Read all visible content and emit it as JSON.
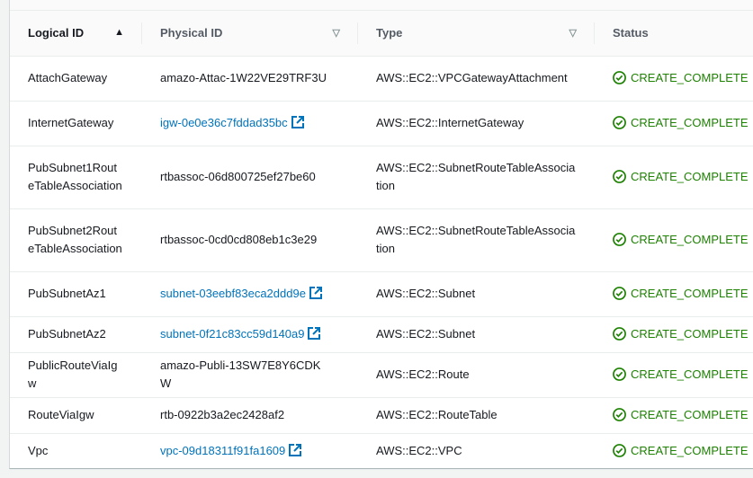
{
  "columns": [
    "Logical ID",
    "Physical ID",
    "Type",
    "Status"
  ],
  "rows": [
    {
      "logical": "AttachGateway",
      "physical": "amazo-Attac-1W22VE29TRF3U",
      "link": false,
      "type": "AWS::EC2::VPCGatewayAttachment",
      "status": "CREATE_COMPLETE",
      "h": 50
    },
    {
      "logical": "InternetGateway",
      "physical": "igw-0e0e36c7fddad35bc",
      "link": true,
      "type": "AWS::EC2::InternetGateway",
      "status": "CREATE_COMPLETE",
      "h": 50
    },
    {
      "logical": "PubSubnet1RouteTableAssociation",
      "physical": "rtbassoc-06d800725ef27be60",
      "link": false,
      "type": "AWS::EC2::SubnetRouteTableAssociation",
      "status": "CREATE_COMPLETE",
      "h": 70
    },
    {
      "logical": "PubSubnet2RouteTableAssociation",
      "physical": "rtbassoc-0cd0cd808eb1c3e29",
      "link": false,
      "type": "AWS::EC2::SubnetRouteTableAssociation",
      "status": "CREATE_COMPLETE",
      "h": 70
    },
    {
      "logical": "PubSubnetAz1",
      "physical": "subnet-03eebf83eca2ddd9e",
      "link": true,
      "type": "AWS::EC2::Subnet",
      "status": "CREATE_COMPLETE",
      "h": 50
    },
    {
      "logical": "PubSubnetAz2",
      "physical": "subnet-0f21c83cc59d140a9",
      "link": true,
      "type": "AWS::EC2::Subnet",
      "status": "CREATE_COMPLETE",
      "h": 40
    },
    {
      "logical": "PublicRouteViaIgw",
      "physical": "amazo-Publi-13SW7E8Y6CDKW",
      "link": false,
      "type": "AWS::EC2::Route",
      "status": "CREATE_COMPLETE",
      "h": 50
    },
    {
      "logical": "RouteViaIgw",
      "physical": "rtb-0922b3a2ec2428af2",
      "link": false,
      "type": "AWS::EC2::RouteTable",
      "status": "CREATE_COMPLETE",
      "h": 40
    },
    {
      "logical": "Vpc",
      "physical": "vpc-09d18311f91fa1609",
      "link": true,
      "type": "AWS::EC2::VPC",
      "status": "CREATE_COMPLETE",
      "h": 40
    }
  ]
}
